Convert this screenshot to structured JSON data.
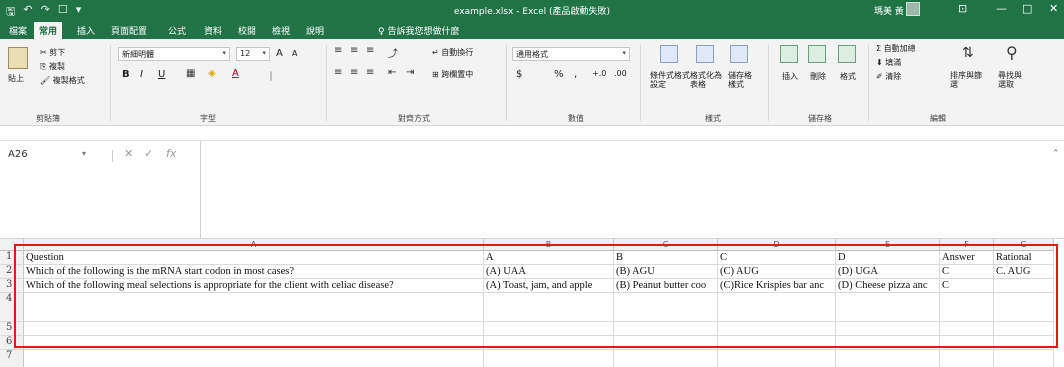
{
  "titlebar": {
    "title": "example.xlsx - Excel (產品啟動失敗)",
    "user": "瑪美 黃",
    "qat_icons": [
      "save-icon",
      "undo-icon",
      "redo-icon",
      "touch-mode-icon",
      "customize-icon"
    ],
    "window_controls": {
      "ribbon_options": "⊡",
      "minimize": "—",
      "maximize": "□",
      "close": "✕"
    }
  },
  "tabs": [
    "檔案",
    "常用",
    "插入",
    "頁面配置",
    "公式",
    "資料",
    "校閱",
    "檢視",
    "說明"
  ],
  "active_tab": "常用",
  "tell_me": "♀ 告訴我您想做什麼",
  "ribbon": {
    "clipboard": {
      "paste": "貼上",
      "cut": "剪下",
      "copy": "複製",
      "format_painter": "複製格式",
      "label": "剪貼簿"
    },
    "font": {
      "name": "新細明體",
      "size": "12",
      "bold": "B",
      "italic": "I",
      "underline": "U",
      "grow": "A",
      "shrink": "A",
      "label": "字型"
    },
    "alignment": {
      "wrap": "自動換行",
      "merge": "跨欄置中",
      "label": "對齊方式"
    },
    "number": {
      "format": "通用格式",
      "currency": "$",
      "percent": "%",
      "comma": ",",
      "inc": "+.0",
      "dec": ".00",
      "label": "數值"
    },
    "styles": {
      "conditional": "條件式格式設定",
      "table": "格式化為表格",
      "cell_styles": "儲存格樣式",
      "label": "樣式"
    },
    "cells": {
      "insert": "插入",
      "delete": "刪除",
      "format": "格式",
      "label": "儲存格"
    },
    "editing": {
      "autosum": "自動加總",
      "fill": "填滿",
      "clear": "清除",
      "sort": "排序與篩選",
      "find": "尋找與選取",
      "label": "編輯"
    }
  },
  "formula_bar": {
    "name_box": "A26",
    "cancel": "✕",
    "enter": "✓",
    "fx": "fx",
    "value": ""
  },
  "columns": [
    {
      "id": "A"
    },
    {
      "id": "B"
    },
    {
      "id": "C"
    },
    {
      "id": "D"
    },
    {
      "id": "E"
    },
    {
      "id": "F"
    },
    {
      "id": "G"
    }
  ],
  "rows": [
    {
      "num": "1",
      "cells": [
        "Question",
        "A",
        "B",
        "C",
        "D",
        "Answer",
        "Rational"
      ]
    },
    {
      "num": "2",
      "cells": [
        "Which of the following is the mRNA start codon in most cases?",
        "(A) UAA",
        "(B) AGU",
        "(C) AUG",
        "(D) UGA",
        "C",
        "C. AUG"
      ]
    },
    {
      "num": "3",
      "cells": [
        "Which of the following meal selections is appropriate for the client with celiac disease?",
        "(A) Toast, jam, and apple",
        "(B) Peanut butter coo",
        "(C)Rice Krispies bar anc",
        "(D) Cheese pizza anc",
        "C",
        ""
      ]
    },
    {
      "num": "4",
      "cells": [
        "",
        "",
        "",
        "",
        "",
        "",
        ""
      ]
    },
    {
      "num": "5",
      "cells": [
        "",
        "",
        "",
        "",
        "",
        "",
        ""
      ]
    },
    {
      "num": "6",
      "cells": [
        "",
        "",
        "",
        "",
        "",
        "",
        ""
      ]
    },
    {
      "num": "7",
      "cells": [
        "",
        "",
        "",
        "",
        "",
        "",
        ""
      ]
    }
  ],
  "colors": {
    "excel_green": "#217346",
    "highlight_red": "#e21a1a"
  }
}
